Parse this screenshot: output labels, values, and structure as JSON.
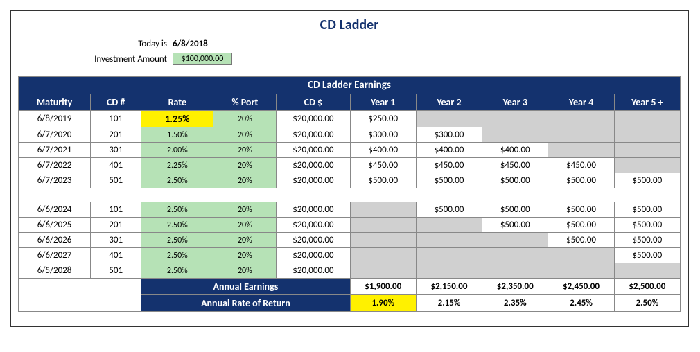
{
  "title": "CD Ladder",
  "today_label": "Today is",
  "today": "6/8/2018",
  "invest_label": "Investment Amount",
  "invest_value": "$100,000.00",
  "section_title": "CD Ladder Earnings",
  "columns": [
    "Maturity",
    "CD #",
    "Rate",
    "% Port",
    "CD $",
    "Year 1",
    "Year 2",
    "Year 3",
    "Year 4",
    "Year 5 +"
  ],
  "group1": [
    {
      "maturity": "6/8/2019",
      "cd": "101",
      "rate": "1.25%",
      "rate_highlight": true,
      "port": "20%",
      "amt": "$20,000.00",
      "y": [
        "$250.00",
        "",
        "",
        "",
        ""
      ]
    },
    {
      "maturity": "6/7/2020",
      "cd": "201",
      "rate": "1.50%",
      "port": "20%",
      "amt": "$20,000.00",
      "y": [
        "$300.00",
        "$300.00",
        "",
        "",
        ""
      ]
    },
    {
      "maturity": "6/7/2021",
      "cd": "301",
      "rate": "2.00%",
      "port": "20%",
      "amt": "$20,000.00",
      "y": [
        "$400.00",
        "$400.00",
        "$400.00",
        "",
        ""
      ]
    },
    {
      "maturity": "6/7/2022",
      "cd": "401",
      "rate": "2.25%",
      "port": "20%",
      "amt": "$20,000.00",
      "y": [
        "$450.00",
        "$450.00",
        "$450.00",
        "$450.00",
        ""
      ]
    },
    {
      "maturity": "6/7/2023",
      "cd": "501",
      "rate": "2.50%",
      "port": "20%",
      "amt": "$20,000.00",
      "y": [
        "$500.00",
        "$500.00",
        "$500.00",
        "$500.00",
        "$500.00"
      ]
    }
  ],
  "group2": [
    {
      "maturity": "6/6/2024",
      "cd": "101",
      "rate": "2.50%",
      "port": "20%",
      "amt": "$20,000.00",
      "y": [
        "",
        "$500.00",
        "$500.00",
        "$500.00",
        "$500.00"
      ]
    },
    {
      "maturity": "6/6/2025",
      "cd": "201",
      "rate": "2.50%",
      "port": "20%",
      "amt": "$20,000.00",
      "y": [
        "",
        "",
        "$500.00",
        "$500.00",
        "$500.00"
      ]
    },
    {
      "maturity": "6/6/2026",
      "cd": "301",
      "rate": "2.50%",
      "port": "20%",
      "amt": "$20,000.00",
      "y": [
        "",
        "",
        "",
        "$500.00",
        "$500.00"
      ]
    },
    {
      "maturity": "6/6/2027",
      "cd": "401",
      "rate": "2.50%",
      "port": "20%",
      "amt": "$20,000.00",
      "y": [
        "",
        "",
        "",
        "",
        "$500.00"
      ]
    },
    {
      "maturity": "6/5/2028",
      "cd": "501",
      "rate": "2.50%",
      "port": "20%",
      "amt": "$20,000.00",
      "y": [
        "",
        "",
        "",
        "",
        ""
      ]
    }
  ],
  "annual_earn_label": "Annual Earnings",
  "annual_earn": [
    "$1,900.00",
    "$2,150.00",
    "$2,350.00",
    "$2,450.00",
    "$2,500.00"
  ],
  "annual_ror_label": "Annual Rate of Return",
  "annual_ror": [
    "1.90%",
    "2.15%",
    "2.35%",
    "2.45%",
    "2.50%"
  ],
  "chart_data": {
    "type": "table",
    "title": "CD Ladder Earnings",
    "investment": 100000,
    "rows": [
      {
        "maturity": "2019-06-08",
        "cd": 101,
        "rate": 0.0125,
        "port": 0.2,
        "amount": 20000,
        "years": [
          250,
          null,
          null,
          null,
          null
        ]
      },
      {
        "maturity": "2020-06-07",
        "cd": 201,
        "rate": 0.015,
        "port": 0.2,
        "amount": 20000,
        "years": [
          300,
          300,
          null,
          null,
          null
        ]
      },
      {
        "maturity": "2021-06-07",
        "cd": 301,
        "rate": 0.02,
        "port": 0.2,
        "amount": 20000,
        "years": [
          400,
          400,
          400,
          null,
          null
        ]
      },
      {
        "maturity": "2022-06-07",
        "cd": 401,
        "rate": 0.0225,
        "port": 0.2,
        "amount": 20000,
        "years": [
          450,
          450,
          450,
          450,
          null
        ]
      },
      {
        "maturity": "2023-06-07",
        "cd": 501,
        "rate": 0.025,
        "port": 0.2,
        "amount": 20000,
        "years": [
          500,
          500,
          500,
          500,
          500
        ]
      },
      {
        "maturity": "2024-06-06",
        "cd": 101,
        "rate": 0.025,
        "port": 0.2,
        "amount": 20000,
        "years": [
          null,
          500,
          500,
          500,
          500
        ]
      },
      {
        "maturity": "2025-06-06",
        "cd": 201,
        "rate": 0.025,
        "port": 0.2,
        "amount": 20000,
        "years": [
          null,
          null,
          500,
          500,
          500
        ]
      },
      {
        "maturity": "2026-06-06",
        "cd": 301,
        "rate": 0.025,
        "port": 0.2,
        "amount": 20000,
        "years": [
          null,
          null,
          null,
          500,
          500
        ]
      },
      {
        "maturity": "2027-06-06",
        "cd": 401,
        "rate": 0.025,
        "port": 0.2,
        "amount": 20000,
        "years": [
          null,
          null,
          null,
          null,
          500
        ]
      },
      {
        "maturity": "2028-06-05",
        "cd": 501,
        "rate": 0.025,
        "port": 0.2,
        "amount": 20000,
        "years": [
          null,
          null,
          null,
          null,
          null
        ]
      }
    ],
    "annual_earnings": [
      1900,
      2150,
      2350,
      2450,
      2500
    ],
    "annual_rate_of_return": [
      0.019,
      0.0215,
      0.0235,
      0.0245,
      0.025
    ]
  }
}
